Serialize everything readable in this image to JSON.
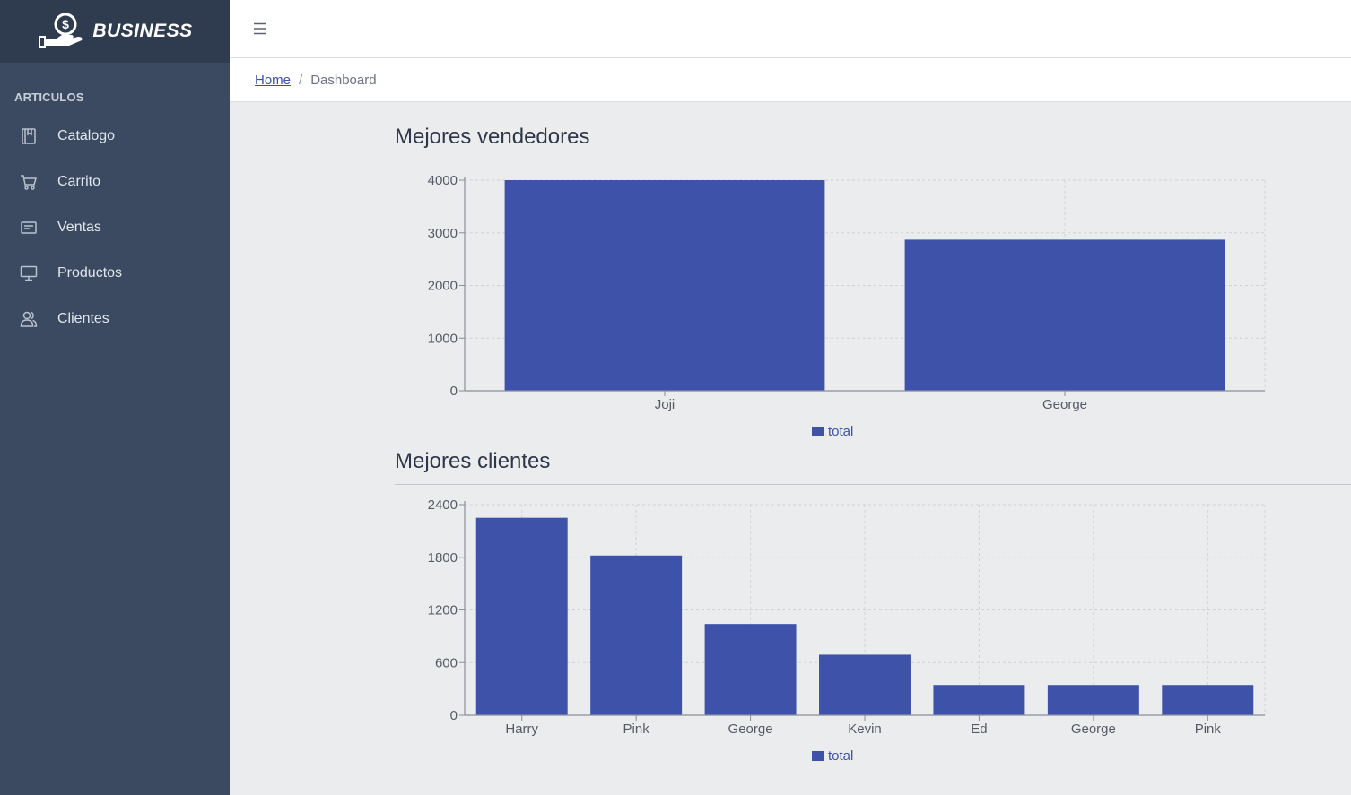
{
  "brand": {
    "name": "BUSINESS",
    "logo_icon": "money-hand-icon"
  },
  "sidebar": {
    "section_title": "ARTICULOS",
    "items": [
      {
        "label": "Catalogo",
        "icon": "book-icon"
      },
      {
        "label": "Carrito",
        "icon": "cart-icon"
      },
      {
        "label": "Ventas",
        "icon": "receipt-icon"
      },
      {
        "label": "Productos",
        "icon": "monitor-icon"
      },
      {
        "label": "Clientes",
        "icon": "users-icon"
      }
    ]
  },
  "topbar": {
    "menu_icon": "hamburger-icon"
  },
  "breadcrumb": {
    "home": "Home",
    "separator": "/",
    "current": "Dashboard"
  },
  "colors": {
    "bar": "#3d52a8",
    "sidebar": "#3b4a60",
    "brand_bg": "#2f3b4e"
  },
  "chart_data": [
    {
      "type": "bar",
      "title": "Mejores vendedores",
      "categories": [
        "Joji",
        "George"
      ],
      "series": [
        {
          "name": "total",
          "values": [
            4000,
            2870
          ]
        }
      ],
      "yticks": [
        0,
        1000,
        2000,
        3000,
        4000
      ],
      "ylim": [
        0,
        4000
      ],
      "grid": true,
      "legend": "bottom-center"
    },
    {
      "type": "bar",
      "title": "Mejores clientes",
      "categories": [
        "Harry",
        "Pink",
        "George",
        "Kevin",
        "Ed",
        "George",
        "Pink"
      ],
      "series": [
        {
          "name": "total",
          "values": [
            2250,
            1820,
            1040,
            690,
            345,
            345,
            345
          ]
        }
      ],
      "yticks": [
        0,
        600,
        1200,
        1800,
        2400
      ],
      "ylim": [
        0,
        2400
      ],
      "grid": true,
      "legend": "bottom-center"
    }
  ]
}
